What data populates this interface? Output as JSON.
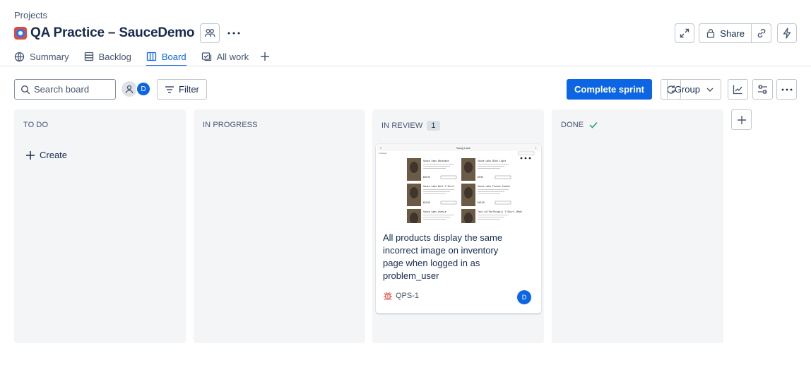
{
  "breadcrumb": "Projects",
  "project": {
    "title": "QA Practice – SauceDemo"
  },
  "header": {
    "share_label": "Share"
  },
  "tabs": [
    {
      "label": "Summary",
      "icon": "globe-icon"
    },
    {
      "label": "Backlog",
      "icon": "backlog-icon"
    },
    {
      "label": "Board",
      "icon": "board-icon",
      "active": true
    },
    {
      "label": "All work",
      "icon": "all-work-icon"
    }
  ],
  "toolbar": {
    "search_placeholder": "Search board",
    "avatar_initial": "D",
    "filter_label": "Filter",
    "complete_sprint_label": "Complete sprint",
    "group_label": "Group"
  },
  "columns": [
    {
      "title": "TO DO",
      "create_label": "Create"
    },
    {
      "title": "IN PROGRESS"
    },
    {
      "title": "IN REVIEW",
      "count": "1"
    },
    {
      "title": "DONE"
    }
  ],
  "card": {
    "title": "All products display the same incorrect image on inventory page when logged in as problem_user",
    "key": "QPS-1",
    "assignee_initial": "D",
    "thumbnail": {
      "header": "Swag Labs",
      "sub": "Products",
      "items": [
        {
          "name": "Sauce Labs Backpack",
          "price": "$29.99"
        },
        {
          "name": "Sauce Labs Bike Light",
          "price": "$9.99"
        },
        {
          "name": "Sauce Labs Bolt T-Shirt",
          "price": "$15.99"
        },
        {
          "name": "Sauce Labs Fleece Jacket",
          "price": "$49.99"
        },
        {
          "name": "Sauce Labs Onesie",
          "price": ""
        },
        {
          "name": "Test.allTheThings() T-Shirt (Red)",
          "price": ""
        }
      ]
    }
  },
  "colors": {
    "accent": "#0c66e4",
    "bug": "#e2483d",
    "done_check": "#22a06b"
  }
}
